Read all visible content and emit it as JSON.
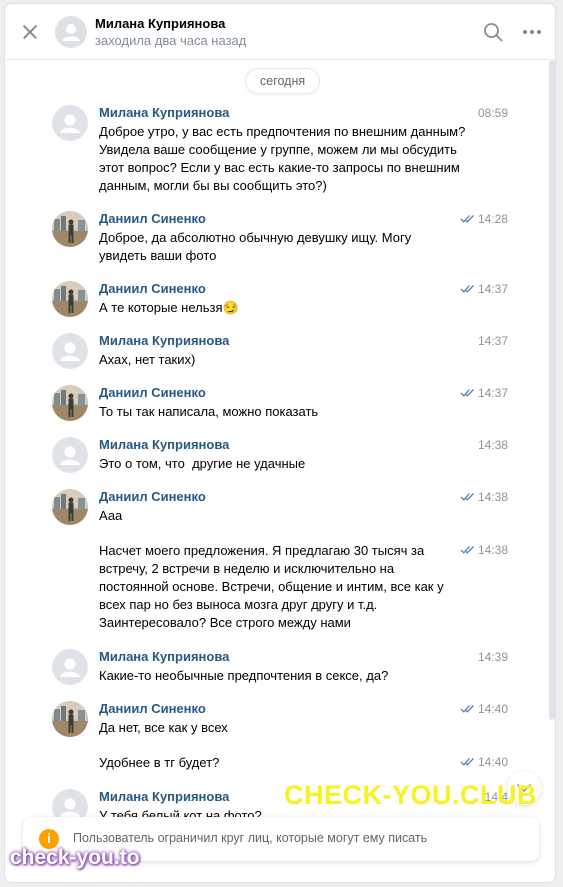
{
  "header": {
    "contact_name": "Милана Куприянова",
    "contact_status": "заходила два часа назад"
  },
  "date_separator": "сегодня",
  "messages": [
    {
      "author": "Милана Куприянова",
      "time": "08:59",
      "read": false,
      "text": "Доброе утро, у вас есть предпочтения по внешним данным?\nУвидела ваше сообщение у группе, можем ли мы обсудить\nэтот вопрос? Если у вас есть какие-то запросы по внешним\nданным, могли бы вы сообщить это?)"
    },
    {
      "author": "Даниил Синенко",
      "time": "14:28",
      "read": true,
      "text": "Доброе, да абсолютно обычную девушку ищу. Могу\nувидеть ваши фото"
    },
    {
      "author": "Даниил Синенко",
      "time": "14:37",
      "read": true,
      "text": "А те которые нельзя",
      "emoji": "😏"
    },
    {
      "author": "Милана Куприянова",
      "time": "14:37",
      "read": false,
      "text": "Ахах, нет таких)"
    },
    {
      "author": "Даниил Синенко",
      "time": "14:37",
      "read": true,
      "text": "То ты так написала, можно показать"
    },
    {
      "author": "Милана Куприянова",
      "time": "14:38",
      "read": false,
      "text": "Это о том, что  другие не удачные"
    },
    {
      "author": "Даниил Синенко",
      "time": "14:38",
      "read": true,
      "text": "Ааа"
    },
    {
      "author": "",
      "time": "14:38",
      "read": true,
      "text": "Насчет моего предложения. Я предлагаю 30 тысяч за\nвстречу, 2 встречи в неделю и исключительно на\nпостоянной основе. Встречи, общение и интим, все как у\nвсех пар но без выноса мозга друг другу и т.д.\nЗаинтересовало? Все строго между нами"
    },
    {
      "author": "Милана Куприянова",
      "time": "14:39",
      "read": false,
      "text": "Какие-то необычные предпочтения в сексе, да?"
    },
    {
      "author": "Даниил Синенко",
      "time": "14:40",
      "read": true,
      "text": "Да нет, все как у всех"
    },
    {
      "author": "",
      "time": "14:40",
      "read": true,
      "text": "Удобнее в тг будет?"
    },
    {
      "author": "Милана Куприянова",
      "time": "14:4",
      "read": false,
      "text": "У тебя белый кот на фото?"
    }
  ],
  "notice": {
    "icon": "info-icon",
    "icon_glyph": "i",
    "text": "Пользователь ограничил круг лиц, которые могут ему писать"
  },
  "watermarks": {
    "large": "CHECK-YOU.CLUB",
    "small": "check-you.to"
  },
  "colors": {
    "author_link": "#2a5885",
    "read_check": "#5181b8",
    "notice_icon": "#ffa000",
    "watermark_yellow": "#f7f221"
  }
}
